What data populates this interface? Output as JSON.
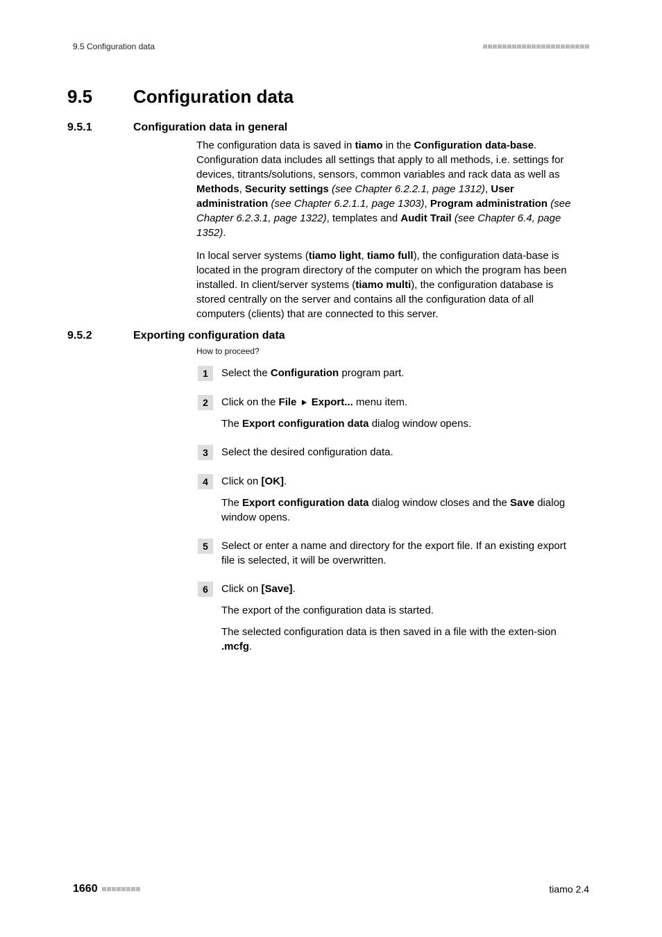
{
  "header": {
    "left": "9.5 Configuration data"
  },
  "section": {
    "num": "9.5",
    "label": "Configuration data"
  },
  "sub1": {
    "num": "9.5.1",
    "label": "Configuration data in general",
    "p1a": "The configuration data is saved in ",
    "p1b": "tiamo",
    "p1c": " in the ",
    "p1d": "Configuration data-base",
    "p1e": ". Configuration data includes all settings that apply to all methods, i.e. settings for devices, titrants/solutions, sensors, common variables and rack data as well as ",
    "p1f": "Methods",
    "p1g": ", ",
    "p1h": "Security settings",
    "p1i": " (see Chapter 6.2.2.1, page 1312)",
    "p1j": ", ",
    "p1k": "User administration",
    "p1l": " (see Chapter 6.2.1.1, page 1303)",
    "p1m": ", ",
    "p1n": "Program administration",
    "p1o": " (see Chapter 6.2.3.1, page 1322)",
    "p1p": ", templates and ",
    "p1q": "Audit Trail",
    "p1r": " (see Chapter 6.4, page 1352)",
    "p1s": ".",
    "p2a": "In local server systems (",
    "p2b": "tiamo light",
    "p2c": ", ",
    "p2d": "tiamo full",
    "p2e": "), the configuration data-base is located in the program directory of the computer on which the program has been installed. In client/server systems (",
    "p2f": "tiamo multi",
    "p2g": "), the configuration database is stored centrally on the server and contains all the configuration data of all computers (clients) that are connected to this server."
  },
  "sub2": {
    "num": "9.5.2",
    "label": "Exporting configuration data",
    "howto": "How to proceed?"
  },
  "steps": {
    "s1": {
      "n": "1",
      "a": "Select the ",
      "b": "Configuration",
      "c": " program part."
    },
    "s2": {
      "n": "2",
      "a": "Click on the ",
      "b": "File",
      "c": "Export...",
      "d": " menu item.",
      "e": "The ",
      "f": "Export configuration data",
      "g": " dialog window opens."
    },
    "s3": {
      "n": "3",
      "a": "Select the desired configuration data."
    },
    "s4": {
      "n": "4",
      "a": "Click on ",
      "b": "[OK]",
      "c": ".",
      "d": "The ",
      "e": "Export configuration data",
      "f": " dialog window closes and the ",
      "g": "Save",
      "h": " dialog window opens."
    },
    "s5": {
      "n": "5",
      "a": "Select or enter a name and directory for the export file. If an existing export file is selected, it will be overwritten."
    },
    "s6": {
      "n": "6",
      "a": "Click on ",
      "b": "[Save]",
      "c": ".",
      "d": "The export of the configuration data is started.",
      "e": "The selected configuration data is then saved in a file with the exten-sion ",
      "f": ".mcfg",
      "g": "."
    }
  },
  "footer": {
    "page": "1660",
    "right": "tiamo 2.4"
  }
}
